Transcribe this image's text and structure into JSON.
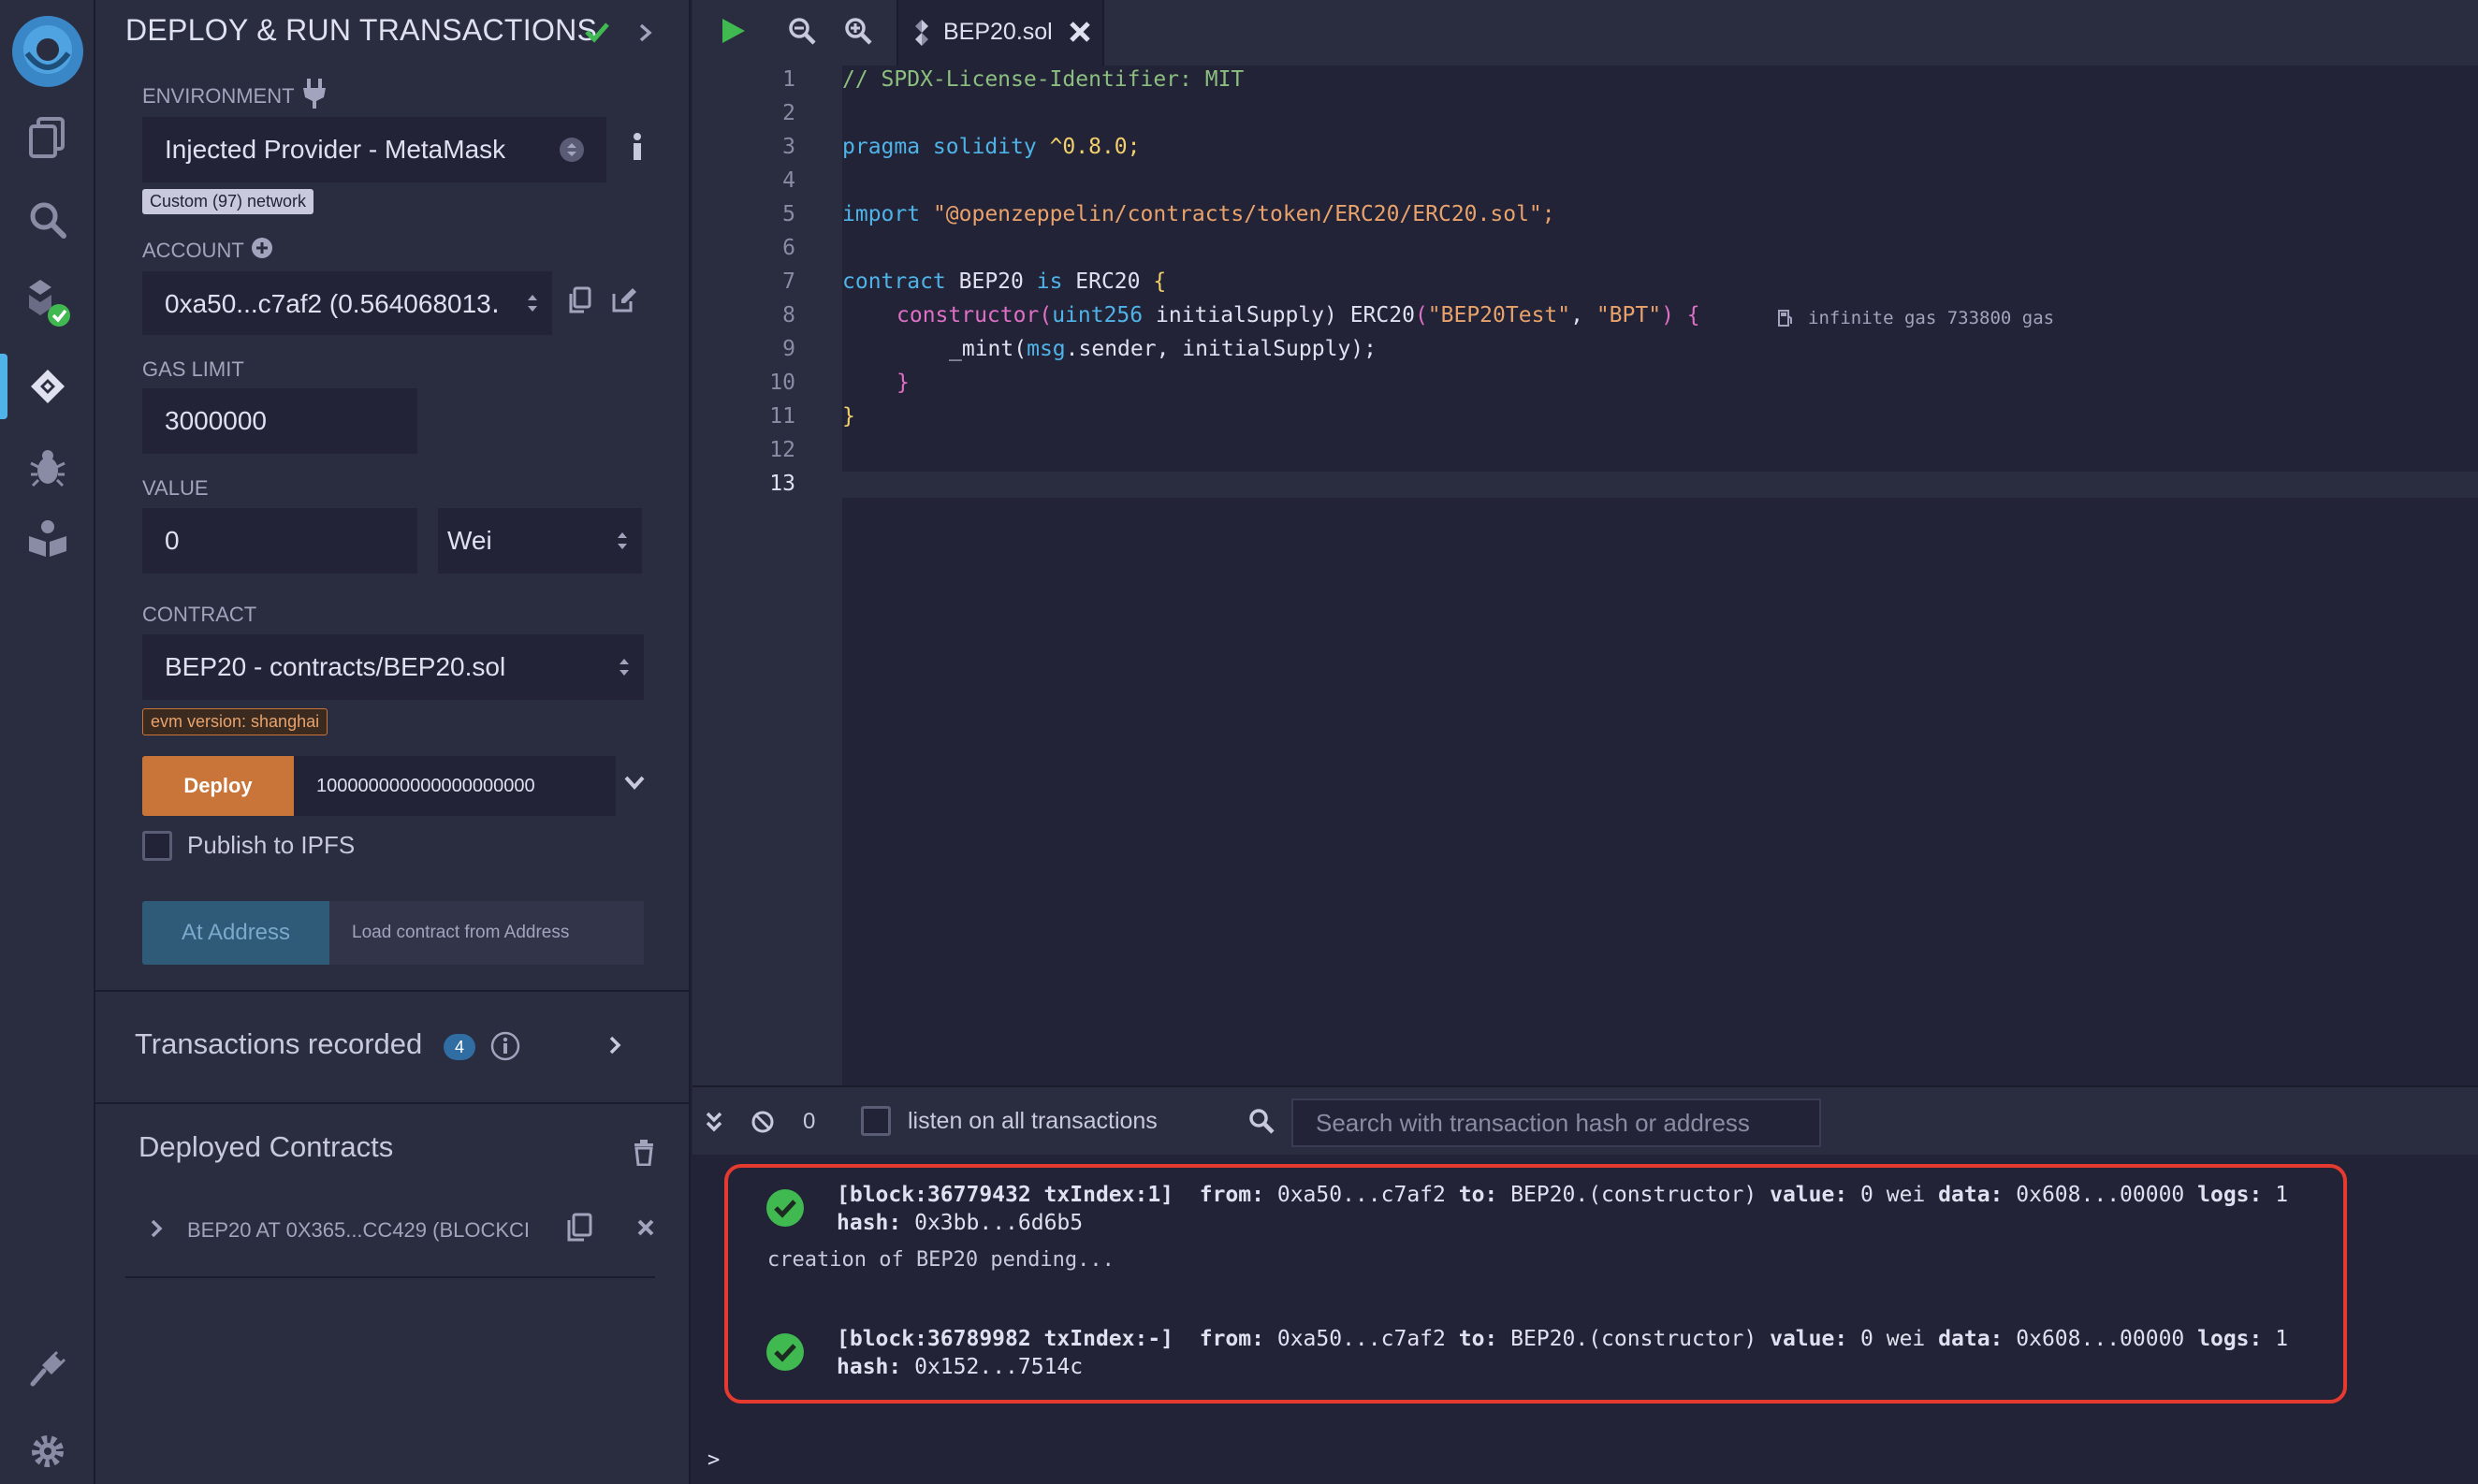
{
  "sidebar_panel": {
    "title": "DEPLOY & RUN TRANSACTIONS",
    "environment": {
      "label": "ENVIRONMENT",
      "value": "Injected Provider - MetaMask",
      "network_badge": "Custom (97) network"
    },
    "account": {
      "label": "ACCOUNT",
      "value": "0xa50...c7af2 (0.564068013․"
    },
    "gas_limit": {
      "label": "GAS LIMIT",
      "value": "3000000"
    },
    "value": {
      "label": "VALUE",
      "amount": "0",
      "unit": "Wei"
    },
    "contract": {
      "label": "CONTRACT",
      "value": "BEP20 - contracts/BEP20.sol",
      "evm_badge": "evm version: shanghai"
    },
    "deploy": {
      "button": "Deploy",
      "arg": "100000000000000000000"
    },
    "publish_ipfs": "Publish to IPFS",
    "at_address": {
      "button": "At Address",
      "placeholder": "Load contract from Address"
    },
    "transactions_recorded": {
      "label": "Transactions recorded",
      "count": "4"
    },
    "deployed_contracts": {
      "title": "Deployed Contracts",
      "items": [
        {
          "label": "BEP20 AT 0X365...CC429 (BLOCKCI"
        }
      ]
    }
  },
  "editor": {
    "tab": {
      "filename": "BEP20.sol"
    },
    "lines": [
      "1",
      "2",
      "3",
      "4",
      "5",
      "6",
      "7",
      "8",
      "9",
      "10",
      "11",
      "12",
      "13"
    ],
    "code": {
      "l1": "// SPDX-License-Identifier: MIT",
      "l3_kw": "pragma solidity",
      "l3_ver": " ^0.8.0;",
      "l5_kw": "import",
      "l5_str": " \"@openzeppelin/contracts/token/ERC20/ERC20.sol\";",
      "l7_kw1": "contract",
      "l7_name": " BEP20 ",
      "l7_kw2": "is",
      "l7_base": " ERC20 ",
      "l7_brace": "{",
      "l8_kw": "constructor",
      "l8_p1": "(",
      "l8_type": "uint256",
      "l8_arg": " initialSupply",
      "l8_p2": ") ERC20",
      "l8_p3": "(",
      "l8_s1": "\"BEP20Test\"",
      "l8_comma": ", ",
      "l8_s2": "\"BPT\"",
      "l8_p4": ") ",
      "l8_brace": "{",
      "l8_gas": "infinite gas 733800 gas",
      "l9_fn": "_mint",
      "l9_p1": "(",
      "l9_msg": "msg",
      "l9_rest": ".sender, initialSupply",
      "l9_p2": ");",
      "l10_brace": "}",
      "l11_brace": "}"
    }
  },
  "terminal": {
    "count": "0",
    "listen_label": "listen on all transactions",
    "search_placeholder": "Search with transaction hash or address",
    "logs": [
      {
        "block": "[block:36779432 txIndex:1]",
        "from_label": "from:",
        "from": "0xa50...c7af2",
        "to_label": "to:",
        "to": "BEP20.(constructor)",
        "value_label": "value:",
        "value": "0 wei",
        "data_label": "data:",
        "data": "0x608...00000",
        "logs_label": "logs:",
        "logs": "1",
        "hash_label": "hash:",
        "hash": "0x3bb...6d6b5"
      },
      {
        "block": "[block:36789982 txIndex:-]",
        "from_label": "from:",
        "from": "0xa50...c7af2",
        "to_label": "to:",
        "to": "BEP20.(constructor)",
        "value_label": "value:",
        "value": "0 wei",
        "data_label": "data:",
        "data": "0x608...00000",
        "logs_label": "logs:",
        "logs": "1",
        "hash_label": "hash:",
        "hash": "0x152...7514c"
      }
    ],
    "pending": "creation of BEP20 pending...",
    "prompt": ">"
  },
  "colors": {
    "accent": "#4fb3e8",
    "deploy_button": "#c97539",
    "success": "#3fb950",
    "highlight_border": "#e53a2f"
  },
  "icons": [
    "remix-logo",
    "file-explorer-icon",
    "search-icon",
    "compiler-icon",
    "deploy-icon",
    "debugger-icon",
    "learneth-icon",
    "plugin-icon",
    "settings-icon"
  ]
}
